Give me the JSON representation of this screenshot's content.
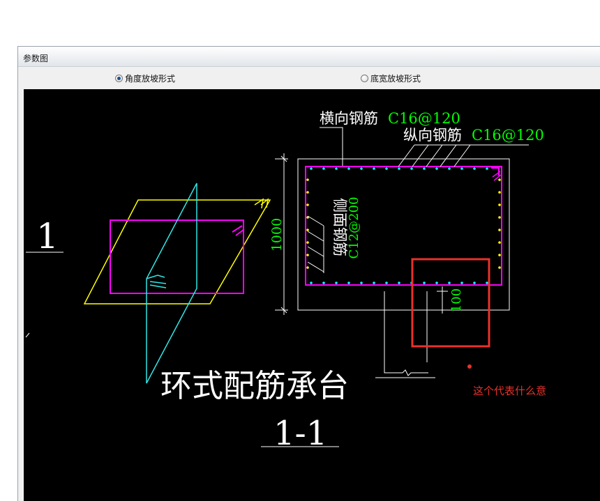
{
  "window": {
    "title": "参数图"
  },
  "options": [
    {
      "label": "角度放坡形式",
      "selected": true
    },
    {
      "label": "底宽放坡形式",
      "selected": false
    }
  ],
  "drawing": {
    "section_mark_left": "1",
    "horizontal_rebar_label": "横向钢筋",
    "horizontal_rebar_spec": "C16@120",
    "longitudinal_rebar_label": "纵向钢筋",
    "longitudinal_rebar_spec": "C16@120",
    "side_rebar_label": "侧面钢筋",
    "side_rebar_spec": "C12@200",
    "height_dim": "1000",
    "cover_dim": "100",
    "main_title": "环式配筋承台",
    "section_title": "1-1"
  },
  "annotation": {
    "text": "这个代表什么意",
    "color": "#e8322b"
  },
  "colors": {
    "rebar": "#ff00ff",
    "spec": "#00ff00",
    "slope": "#ffff00",
    "cyan": "#33e6e6",
    "dot_cyan": "#00ffff",
    "dot_yellow": "#ffff00"
  }
}
